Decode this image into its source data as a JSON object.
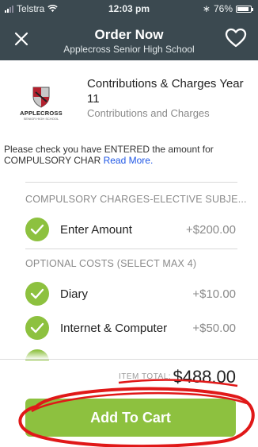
{
  "status_bar": {
    "carrier": "Telstra",
    "time": "12:03 pm",
    "battery": "76%"
  },
  "header": {
    "title": "Order Now",
    "subtitle": "Applecross Senior High School"
  },
  "product": {
    "logo_text": "APPLECROSS",
    "logo_subtext": "SENIOR HIGH SCHOOL",
    "title": "Contributions & Charges Year 11",
    "subtitle": "Contributions and Charges"
  },
  "notice": {
    "text": "Please check you have ENTERED the amount for COMPULSORY CHAR ",
    "link": "Read More."
  },
  "compulsory": {
    "heading": "COMPULSORY CHARGES-ELECTIVE SUBJE...",
    "items": [
      {
        "label": "Enter Amount",
        "price": "+$200.00"
      }
    ]
  },
  "optional": {
    "heading": "OPTIONAL COSTS (SELECT MAX 4)",
    "items": [
      {
        "label": "Diary",
        "price": "+$10.00"
      },
      {
        "label": "Internet & Computer",
        "price": "+$50.00"
      }
    ]
  },
  "footer": {
    "total_label": "ITEM TOTAL:",
    "total_amount": "$488.00",
    "button": "Add To Cart"
  },
  "colors": {
    "header": "#3b4950",
    "accent": "#8dc13f",
    "link": "#1f57e6",
    "annotation": "#e01818"
  },
  "icons": {
    "close": "close-icon",
    "favorite": "heart-icon",
    "check": "checkmark-icon"
  }
}
